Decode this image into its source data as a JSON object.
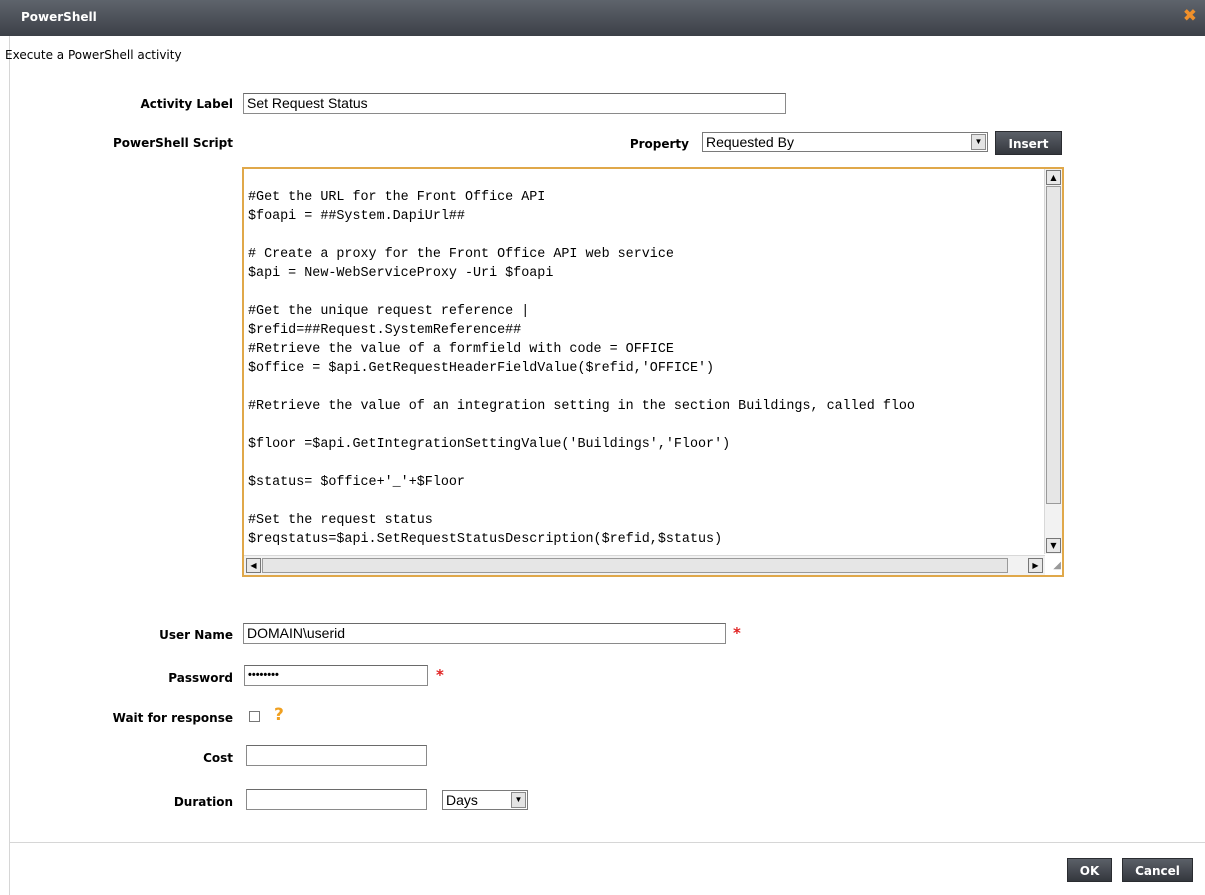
{
  "window": {
    "title": "PowerShell",
    "close_icon": "close-icon"
  },
  "subtitle": "Execute a PowerShell activity",
  "activity_label": {
    "label": "Activity Label",
    "value": "Set Request Status"
  },
  "script": {
    "label": "PowerShell Script",
    "property_label": "Property",
    "property_value": "Requested By",
    "insert_label": "Insert",
    "code": "#Get the URL for the Front Office API\n$foapi = ##System.DapiUrl##\n\n# Create a proxy for the Front Office API web service\n$api = New-WebServiceProxy -Uri $foapi\n\n#Get the unique request reference |\n$refid=##Request.SystemReference##\n#Retrieve the value of a formfield with code = OFFICE\n$office = $api.GetRequestHeaderFieldValue($refid,'OFFICE')\n\n#Retrieve the value of an integration setting in the section Buildings, called floo\n\n$floor =$api.GetIntegrationSettingValue('Buildings','Floor')\n\n$status= $office+'_'+$Floor\n\n#Set the request status\n$reqstatus=$api.SetRequestStatusDescription($refid,$status)"
  },
  "user_name": {
    "label": "User Name",
    "value": "DOMAIN\\userid",
    "required": "*"
  },
  "password": {
    "label": "Password",
    "value": "••••••••",
    "required": "*"
  },
  "wait": {
    "label": "Wait for response",
    "help": "?"
  },
  "cost": {
    "label": "Cost",
    "value": ""
  },
  "duration": {
    "label": "Duration",
    "value": "",
    "unit": "Days"
  },
  "footer": {
    "ok_label": "OK",
    "cancel_label": "Cancel"
  }
}
